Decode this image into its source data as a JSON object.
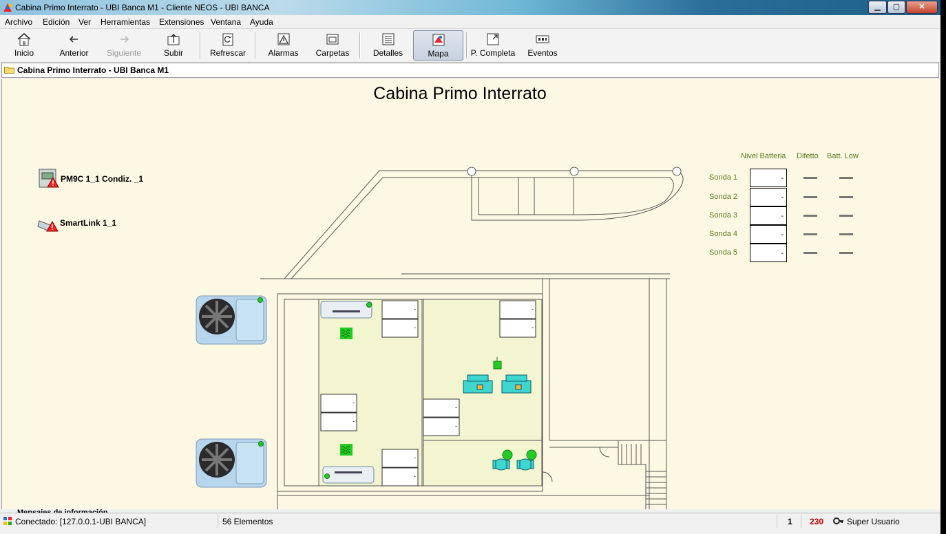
{
  "window": {
    "title": "Cabina Primo Interrato - UBI Banca M1 - Cliente NEOS - UBI BANCA",
    "minimize": "▁",
    "maximize": "▢",
    "close": "✕"
  },
  "menu": [
    "Archivo",
    "Edición",
    "Ver",
    "Herramientas",
    "Extensiones",
    "Ventana",
    "Ayuda"
  ],
  "toolbar": {
    "inicio": "Inicio",
    "anterior": "Anterior",
    "siguiente": "Siguiente",
    "subir": "Subir",
    "refrescar": "Refrescar",
    "alarmas": "Alarmas",
    "carpetas": "Carpetas",
    "detalles": "Detalles",
    "mapa": "Mapa",
    "p_completa": "P. Completa",
    "eventos": "Eventos"
  },
  "path": "Cabina Primo Interrato - UBI Banca M1",
  "map": {
    "title": "Cabina Primo Interrato",
    "devices": [
      {
        "label": "PM9C 1_1 Condiz. _1"
      },
      {
        "label": "SmartLink 1_1"
      }
    ],
    "sonda_table": {
      "headers": [
        "Nivel Batteria",
        "Difetto",
        "Batt. Low"
      ],
      "rows": [
        {
          "label": "Sonda 1",
          "value": "-"
        },
        {
          "label": "Sonda 2",
          "value": "-"
        },
        {
          "label": "Sonda 3",
          "value": "-"
        },
        {
          "label": "Sonda 4",
          "value": "-"
        },
        {
          "label": "Sonda 5",
          "value": "-"
        }
      ]
    },
    "cabinet_value": "-"
  },
  "status": {
    "connection": "Conectado: [127.0.0.1-UBI BANCA]",
    "elements": "56 Elementos",
    "count": "1",
    "alarm_count": "230",
    "user": "Super Usuario",
    "ghost_text": "Mensajes de información"
  },
  "colors": {
    "canvas_bg": "#fdf8e4",
    "room_fill": "#f2f5cf",
    "ok_green": "#22cc22",
    "alarm_red": "#cc0000",
    "label_green": "#5a7a1c"
  }
}
